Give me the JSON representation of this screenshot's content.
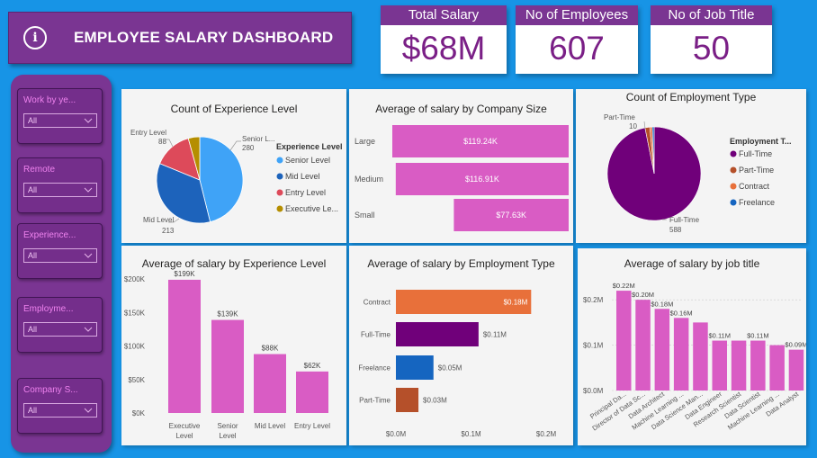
{
  "header": {
    "title": "EMPLOYEE  SALARY DASHBOARD",
    "info_icon": "info-icon"
  },
  "kpis": [
    {
      "label": "Total Salary",
      "value": "$68M"
    },
    {
      "label": "No of Employees",
      "value": "607"
    },
    {
      "label": "No of Job Title",
      "value": "50"
    }
  ],
  "slicers": [
    {
      "label": "Work by ye...",
      "value": "All"
    },
    {
      "label": "Remote",
      "value": "All"
    },
    {
      "label": "Experience...",
      "value": "All"
    },
    {
      "label": "Employme...",
      "value": "All"
    },
    {
      "label": "Company S...",
      "value": "All"
    }
  ],
  "colors": {
    "purple": "#7a3592",
    "pink": "#d95cc4",
    "orange": "#e8703a",
    "darkpurple": "#70007a",
    "blue": "#1565c0",
    "rust": "#b5502a"
  },
  "chart_data": [
    {
      "type": "pie",
      "title": "Count of Experience Level",
      "legend_title": "Experience Level",
      "legend": [
        "Senior Level",
        "Mid Level",
        "Entry Level",
        "Executive Le..."
      ],
      "slices": [
        {
          "name": "Senior Level",
          "label": "Senior L...",
          "value": 280,
          "color": "#3fa3f7"
        },
        {
          "name": "Mid Level",
          "label": "Mid Level",
          "value": 213,
          "color": "#1d63bb"
        },
        {
          "name": "Entry Level",
          "label": "Entry Level",
          "value": 88,
          "color": "#dd4a5a"
        },
        {
          "name": "Executive Level",
          "label": "",
          "value": 26,
          "color": "#b58e00"
        }
      ],
      "legend_placement": "right"
    },
    {
      "type": "bar",
      "orientation": "horizontal",
      "title": "Average of salary by Company Size",
      "categories": [
        "Large",
        "Medium",
        "Small"
      ],
      "values": [
        119.24,
        116.91,
        77.63
      ],
      "data_labels": [
        "$119.24K",
        "$116.91K",
        "$77.63K"
      ],
      "unit": "K"
    },
    {
      "type": "pie",
      "title": "Count of Employment Type",
      "legend_title": "Employment T...",
      "legend": [
        "Full-Time",
        "Part-Time",
        "Contract",
        "Freelance"
      ],
      "legend_colors": [
        "#70007a",
        "#b5502a",
        "#e8703a",
        "#1565c0"
      ],
      "slices": [
        {
          "name": "Full-Time",
          "value": 588,
          "color": "#70007a"
        },
        {
          "name": "Part-Time",
          "value": 10,
          "color": "#b5502a"
        },
        {
          "name": "Contract",
          "value": 5,
          "color": "#e8703a"
        },
        {
          "name": "Freelance",
          "value": 4,
          "color": "#1565c0"
        }
      ],
      "labels": [
        {
          "name": "Part-Time",
          "value": "10"
        },
        {
          "name": "Full-Time",
          "value": "588"
        }
      ],
      "legend_placement": "right"
    },
    {
      "type": "bar",
      "title": "Average of salary by Experience Level",
      "categories": [
        "Executive Level",
        "Senior Level",
        "Mid Level",
        "Entry Level"
      ],
      "category_lines": [
        [
          "Executive",
          "Level"
        ],
        [
          "Senior",
          "Level"
        ],
        [
          "Mid Level"
        ],
        [
          "Entry Level"
        ]
      ],
      "values": [
        199,
        139,
        88,
        62
      ],
      "data_labels": [
        "$199K",
        "$139K",
        "$88K",
        "$62K"
      ],
      "yticks": [
        "$0K",
        "$50K",
        "$100K",
        "$150K",
        "$200K"
      ],
      "ylim": [
        0,
        215
      ],
      "unit": "K"
    },
    {
      "type": "bar",
      "orientation": "horizontal",
      "title": "Average of salary by Employment Type",
      "categories": [
        "Contract",
        "Full-Time",
        "Freelance",
        "Part-Time"
      ],
      "values": [
        0.18,
        0.11,
        0.05,
        0.03
      ],
      "data_labels": [
        "$0.18M",
        "$0.11M",
        "$0.05M",
        "$0.03M"
      ],
      "colors": [
        "#e8703a",
        "#70007a",
        "#1565c0",
        "#b5502a"
      ],
      "xticks": [
        "$0.0M",
        "$0.1M",
        "$0.2M"
      ],
      "xlim": [
        0,
        0.2
      ],
      "unit": "M"
    },
    {
      "type": "bar",
      "title": "Average of salary by job title",
      "categories": [
        "Principal Da...",
        "Director of Data Sc...",
        "Data Architect",
        "Machine Learning ...",
        "Data Science Man...",
        "Data Engineer",
        "Research Scientist",
        "Data Scientist",
        "Machine Learning ...",
        "Data Analyst"
      ],
      "values": [
        0.22,
        0.2,
        0.18,
        0.16,
        0.15,
        0.11,
        0.11,
        0.11,
        0.1,
        0.09
      ],
      "data_labels": [
        "$0.22M",
        "$0.20M",
        "$0.18M",
        "$0.16M",
        "",
        "$0.11M",
        "",
        "$0.11M",
        "",
        "$0.09M"
      ],
      "yticks": [
        "$0.0M",
        "$0.1M",
        "$0.2M"
      ],
      "ylim": [
        0,
        0.24
      ],
      "grid": true,
      "unit": "M"
    }
  ]
}
